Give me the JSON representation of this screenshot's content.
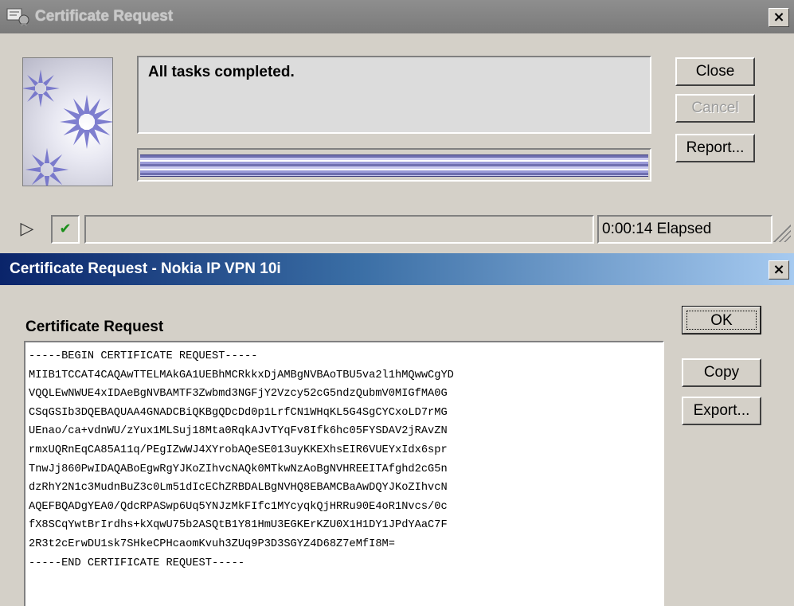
{
  "progress_window": {
    "title": "Certificate Request",
    "close_glyph": "×",
    "message": "All tasks completed.",
    "progress": 1.0,
    "buttons": {
      "close": "Close",
      "cancel": "Cancel",
      "report": "Report..."
    },
    "status_icons": {
      "play": "▷",
      "check": "✔"
    },
    "elapsed": "0:00:14 Elapsed"
  },
  "cert_window": {
    "title": "Certificate Request - Nokia IP VPN 10i",
    "close_glyph": "×",
    "section_label": "Certificate Request",
    "buttons": {
      "ok": "OK",
      "copy": "Copy",
      "export": "Export..."
    },
    "lines": [
      "-----BEGIN CERTIFICATE REQUEST-----",
      "MIIB1TCCAT4CAQAwTTELMAkGA1UEBhMCRkkxDjAMBgNVBAoTBU5va2l1hMQwwCgYD",
      "VQQLEwNWUE4xIDAeBgNVBAMTF3Zwbmd3NGFjY2Vzcy52cG5ndzQubmV0MIGfMA0G",
      "CSqGSIb3DQEBAQUAA4GNADCBiQKBgQDcDd0p1LrfCN1WHqKL5G4SgCYCxoLD7rMG",
      "UEnao/ca+vdnWU/zYux1MLSuj18Mta0RqkAJvTYqFv8Ifk6hc05FYSDAV2jRAvZN",
      "rmxUQRnEqCA85A11q/PEgIZwWJ4XYrobAQeSE013uyKKEXhsEIR6VUEYxIdx6spr",
      "TnwJj860PwIDAQABoEgwRgYJKoZIhvcNAQk0MTkwNzAoBgNVHREEITAfghd2cG5n",
      "dzRhY2N1c3MudnBuZ3c0Lm51dIcEChZRBDALBgNVHQ8EBAMCBaAwDQYJKoZIhvcN",
      "AQEFBQADgYEA0/QdcRPASwp6Uq5YNJzMkFIfc1MYcyqkQjHRRu90E4oR1Nvcs/0c",
      "fX8SCqYwtBrIrdhs+kXqwU75b2ASQtB1Y81HmU3EGKErKZU0X1H1DY1JPdYAaC7F",
      "2R3t2cErwDU1sk7SHkeCPHcaomKvuh3ZUq9P3D3SGYZ4D68Z7eMfI8M=",
      "-----END CERTIFICATE REQUEST-----"
    ]
  }
}
